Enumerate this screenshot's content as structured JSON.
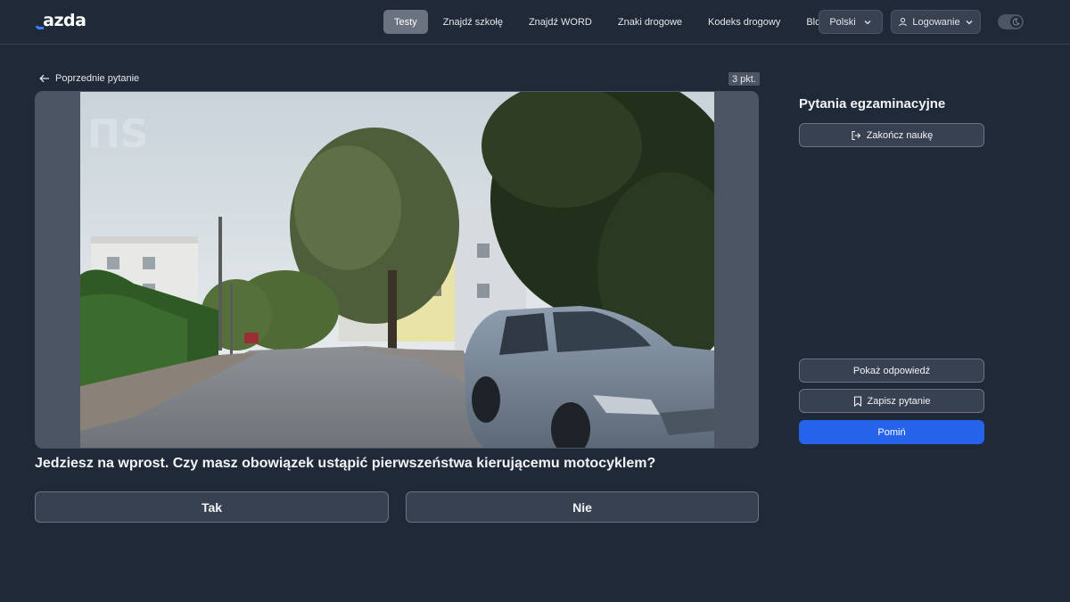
{
  "header": {
    "logo": "Jazda",
    "logo_rest": "azda",
    "nav": [
      {
        "label": "Testy",
        "active": true
      },
      {
        "label": "Znajdź szkołę",
        "active": false
      },
      {
        "label": "Znajdź WORD",
        "active": false
      },
      {
        "label": "Znaki drogowe",
        "active": false
      },
      {
        "label": "Kodeks drogowy",
        "active": false
      },
      {
        "label": "Blog",
        "active": false
      }
    ],
    "language": "Polski",
    "login": "Logowanie",
    "theme_icon": "moon-icon"
  },
  "main": {
    "prev_question": "Poprzednie pytanie",
    "points": "3 pkt.",
    "question": "Jedziesz na wprost. Czy masz obowiązek ustąpić pierwszeństwa kierującemu motocyklem?",
    "answers": [
      "Tak",
      "Nie"
    ]
  },
  "sidebar": {
    "title": "Pytania egzaminacyjne",
    "finish": "Zakończ naukę",
    "show_answer": "Pokaż odpowiedź",
    "save_question": "Zapisz pytanie",
    "skip": "Pomiń"
  },
  "colors": {
    "background": "#1f2937",
    "accent": "#2563eb",
    "nav_active": "#6b7280"
  }
}
